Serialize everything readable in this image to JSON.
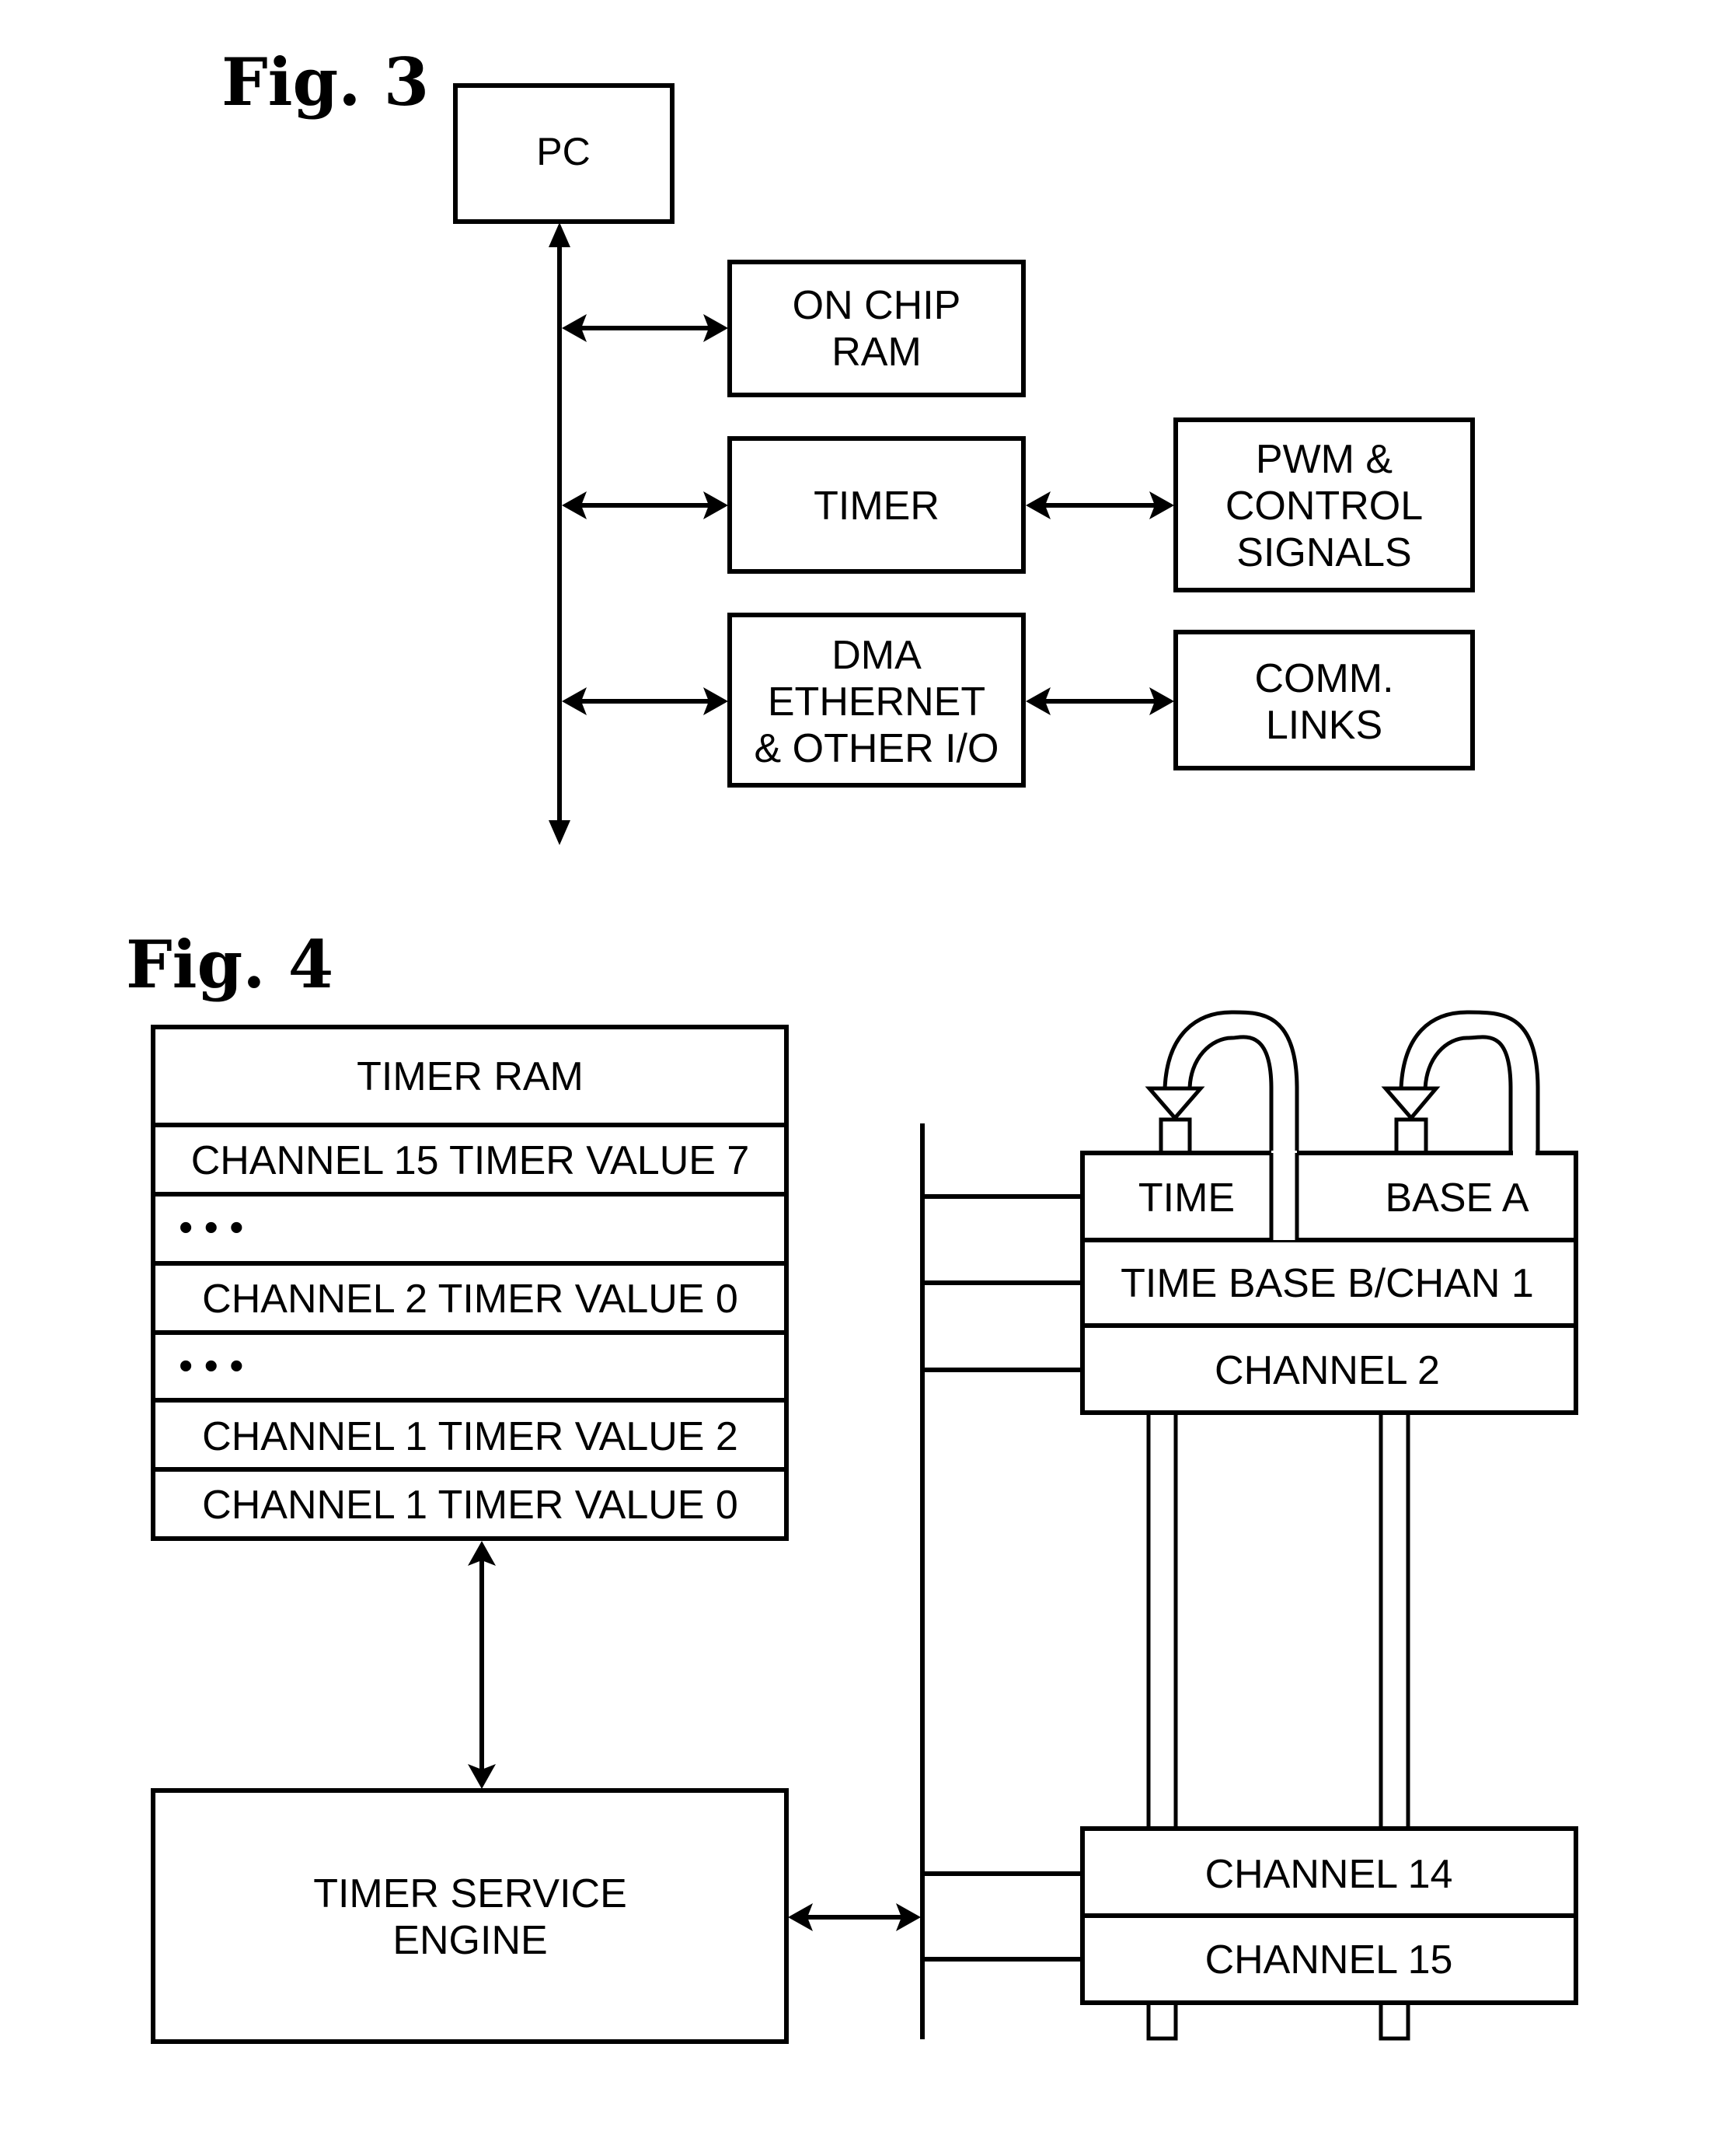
{
  "fig3": {
    "title": "Fig. 3",
    "pc": {
      "label": "PC"
    },
    "blocks": [
      {
        "id": "on-chip-ram",
        "lines": [
          "ON CHIP",
          "RAM"
        ]
      },
      {
        "id": "timer",
        "lines": [
          "TIMER"
        ]
      },
      {
        "id": "dma",
        "lines": [
          "DMA",
          "ETHERNET",
          "& OTHER I/O"
        ]
      }
    ],
    "peripherals": [
      {
        "id": "pwm",
        "lines": [
          "PWM &",
          "CONTROL",
          "SIGNALS"
        ]
      },
      {
        "id": "comm",
        "lines": [
          "COMM.",
          "LINKS"
        ]
      }
    ]
  },
  "fig4": {
    "title": "Fig. 4",
    "timer_ram": {
      "header": "TIMER RAM",
      "rows": [
        "CHANNEL 15 TIMER VALUE 7",
        "• • •",
        "CHANNEL 2 TIMER VALUE 0",
        "• • •",
        "CHANNEL 1 TIMER VALUE 2",
        "CHANNEL 1 TIMER VALUE 0"
      ]
    },
    "engine": {
      "lines": [
        "TIMER SERVICE",
        "ENGINE"
      ]
    },
    "channels_top": {
      "time_base_a": {
        "left": "TIME",
        "right": "BASE A"
      },
      "time_base_b": "TIME BASE B/CHAN 1",
      "channel_2": "CHANNEL 2"
    },
    "channels_bottom": [
      "CHANNEL 14",
      "CHANNEL 15"
    ]
  }
}
